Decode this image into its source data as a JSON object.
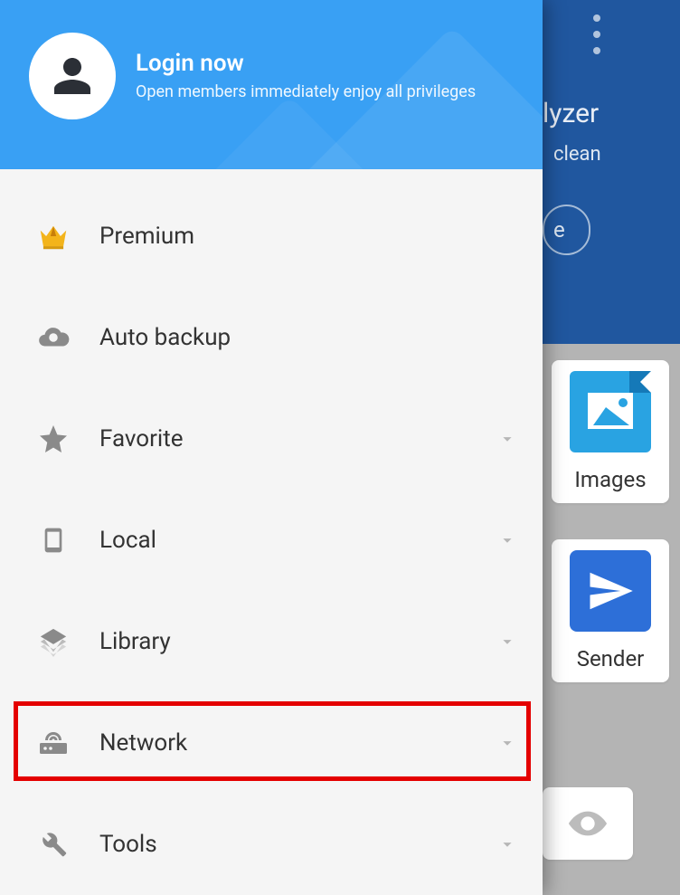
{
  "drawer": {
    "login": {
      "title": "Login now",
      "subtitle": "Open members immediately enjoy all privileges"
    },
    "items": [
      {
        "label": "Premium",
        "icon": "crown-icon",
        "expandable": false
      },
      {
        "label": "Auto backup",
        "icon": "cloud-icon",
        "expandable": false
      },
      {
        "label": "Favorite",
        "icon": "star-icon",
        "expandable": true
      },
      {
        "label": "Local",
        "icon": "phone-icon",
        "expandable": true
      },
      {
        "label": "Library",
        "icon": "layers-icon",
        "expandable": true
      },
      {
        "label": "Network",
        "icon": "network-icon",
        "expandable": true
      },
      {
        "label": "Tools",
        "icon": "wrench-icon",
        "expandable": true
      }
    ]
  },
  "background": {
    "title_fragment": "lyzer",
    "subtitle_fragment": "clean",
    "button_fragment": "e",
    "cards": {
      "images": "Images",
      "sender": "Sender"
    }
  },
  "highlight": "Network"
}
